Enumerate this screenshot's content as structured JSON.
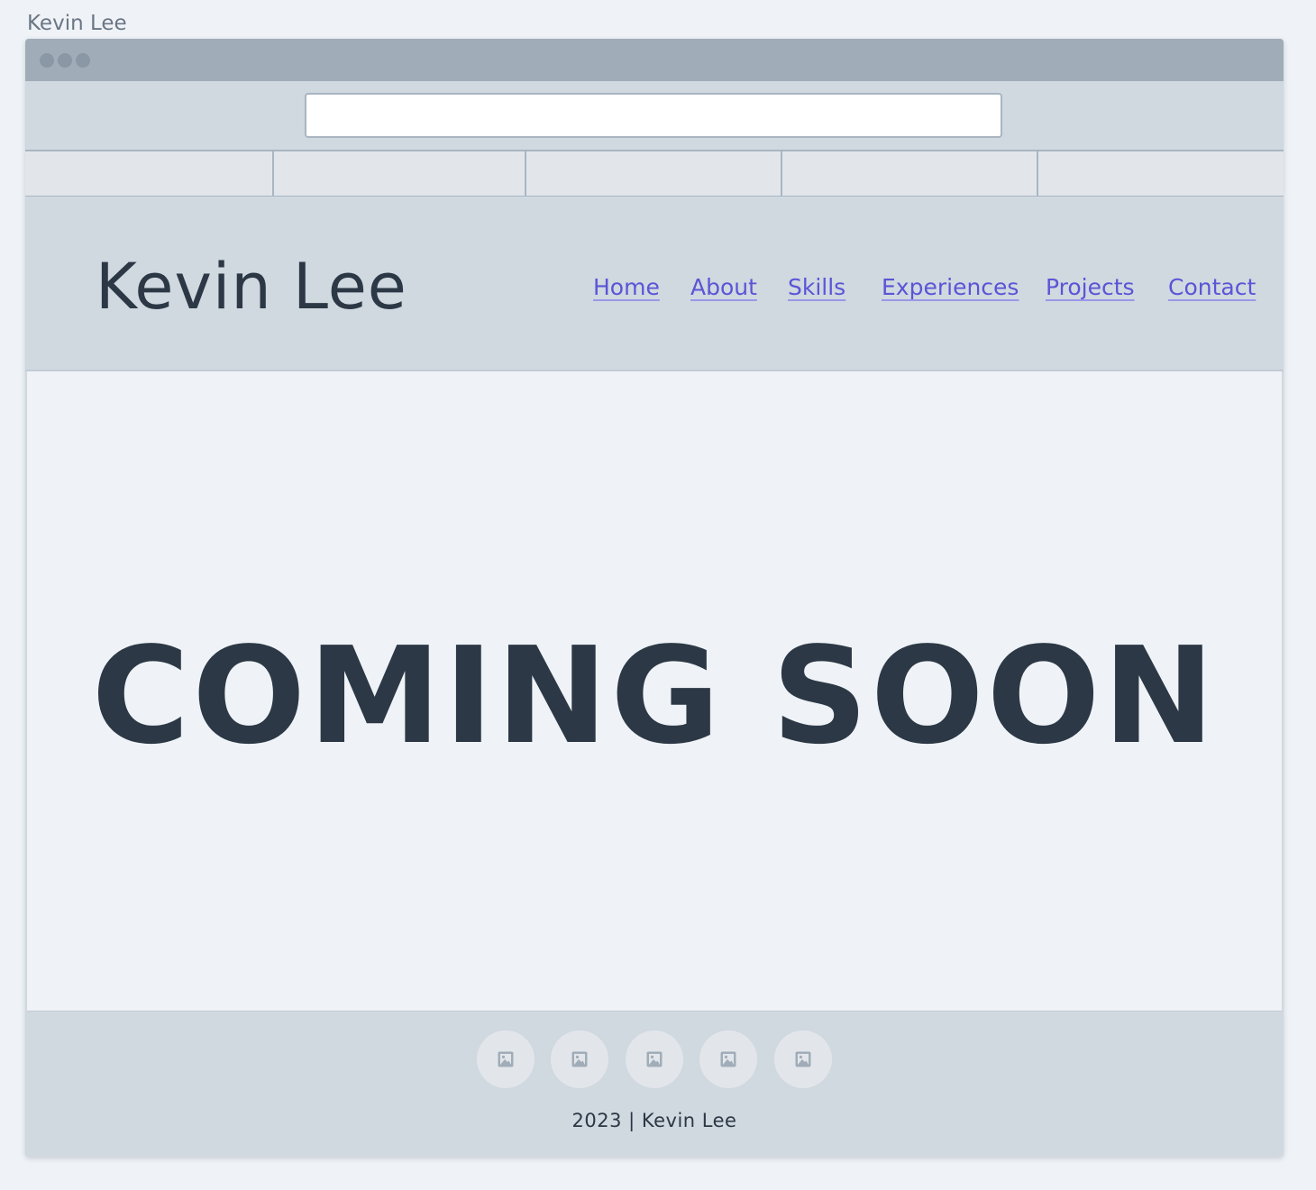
{
  "frame": {
    "label": "Kevin Lee"
  },
  "browser": {
    "address_value": "",
    "tabs": [
      "",
      "",
      "",
      "",
      ""
    ]
  },
  "site": {
    "title": "Kevin Lee",
    "nav": [
      {
        "label": "Home"
      },
      {
        "label": "About"
      },
      {
        "label": "Skills"
      },
      {
        "label": "Experiences"
      },
      {
        "label": "Projects"
      },
      {
        "label": "Contact"
      }
    ],
    "link_color": "#5a55d6"
  },
  "main": {
    "headline": "COMING SOON"
  },
  "footer": {
    "social_icons": [
      "image-icon",
      "image-icon",
      "image-icon",
      "image-icon",
      "image-icon"
    ],
    "copyright": "2023 | Kevin Lee"
  }
}
